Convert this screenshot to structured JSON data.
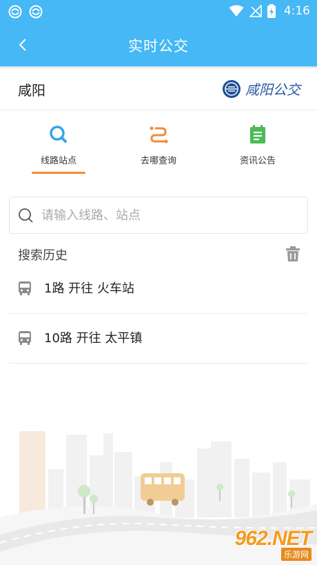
{
  "status_bar": {
    "time": "4:16"
  },
  "header": {
    "title": "实时公交"
  },
  "city_row": {
    "city": "咸阳",
    "brand": "咸阳公交"
  },
  "tabs": [
    {
      "label": "线路站点",
      "icon": "search-icon",
      "active": true
    },
    {
      "label": "去哪查询",
      "icon": "route-icon",
      "active": false
    },
    {
      "label": "资讯公告",
      "icon": "notice-icon",
      "active": false
    }
  ],
  "search": {
    "placeholder": "请输入线路、站点",
    "value": ""
  },
  "history": {
    "title": "搜索历史",
    "items": [
      {
        "text": "1路 开往 火车站"
      },
      {
        "text": "10路 开往 太平镇"
      }
    ]
  },
  "watermark": {
    "main": "962.NET",
    "sub": "乐游网"
  },
  "colors": {
    "header": "#45b8f5",
    "accent": "#f58a3a",
    "brand": "#2b5aa3",
    "notice": "#4cbb55"
  }
}
